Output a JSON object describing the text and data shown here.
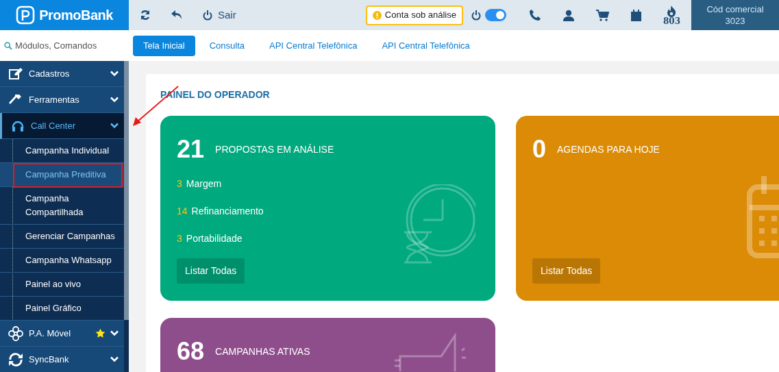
{
  "header": {
    "logo": "PromoBank",
    "actions": [
      {
        "kind": "refresh"
      },
      {
        "kind": "back"
      },
      {
        "kind": "logout",
        "label": "Sair"
      }
    ],
    "status_badge": "Conta sob análise",
    "toggle": {
      "on": true
    },
    "flame_count": "803",
    "commercial": {
      "label": "Cód comercial",
      "code": "3023"
    }
  },
  "search": {
    "placeholder": "Módulos, Comandos"
  },
  "tabs": [
    {
      "label": "Tela Inicial",
      "selected": true
    },
    {
      "label": "Consulta",
      "selected": false
    },
    {
      "label": "API Central Telefônica",
      "selected": false
    },
    {
      "label": "API Central Telefônica",
      "selected": false
    }
  ],
  "sidebar": {
    "items": [
      {
        "label": "Cadastros",
        "expanded": false,
        "starred": false
      },
      {
        "label": "Ferramentas",
        "expanded": false,
        "starred": false
      },
      {
        "label": "Call Center",
        "expanded": true,
        "starred": false,
        "children": [
          {
            "label": "Campanha Individual",
            "selected": false
          },
          {
            "label": "Campanha Preditiva",
            "selected": true
          },
          {
            "label": "Campanha Compartilhada",
            "selected": false
          },
          {
            "label": "Gerenciar Campanhas",
            "selected": false
          },
          {
            "label": "Campanha Whatsapp",
            "selected": false
          },
          {
            "label": "Painel ao vivo",
            "selected": false
          },
          {
            "label": "Painel Gráfico",
            "selected": false
          }
        ]
      },
      {
        "label": "P.A. Móvel",
        "expanded": false,
        "starred": true
      },
      {
        "label": "SyncBank",
        "expanded": false,
        "starred": false
      }
    ]
  },
  "panel": {
    "title": "PAINEL DO OPERADOR",
    "cards": [
      {
        "count": "21",
        "title": "PROPOSTAS EM ANÁLISE",
        "color": "#00a97e",
        "button": "Listar Todas",
        "rows": [
          {
            "count": "3",
            "label": "Margem"
          },
          {
            "count": "14",
            "label": "Refinanciamento"
          },
          {
            "count": "3",
            "label": "Portabilidade"
          }
        ]
      },
      {
        "count": "0",
        "title": "AGENDAS PARA HOJE",
        "color": "#db8b06",
        "button": "Listar Todas"
      },
      {
        "count": "68",
        "title": "CAMPANHAS ATIVAS",
        "color": "#8e4e8b"
      }
    ]
  }
}
